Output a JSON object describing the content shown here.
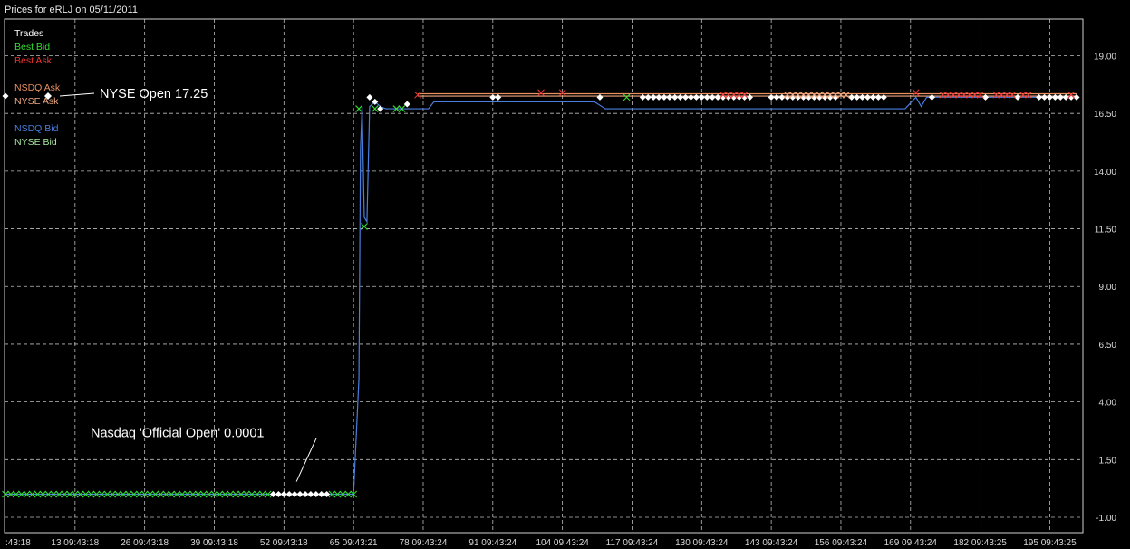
{
  "title": "Prices for  eRLJ  on  05/11/2011",
  "colors": {
    "trades": "#ffffff",
    "best_bid": "#33dd33",
    "best_ask": "#ee3333",
    "nsdq_ask": "#e89060",
    "nyse_ask": "#f0a880",
    "nsdq_bid": "#4a7fe0",
    "nyse_bid": "#a8e8a0",
    "grid": "#bcbcbc"
  },
  "legend": [
    {
      "label": "Trades",
      "color": "#ffffff"
    },
    {
      "label": "Best Bid",
      "color": "#33dd33"
    },
    {
      "label": "Best Ask",
      "color": "#ee3333"
    },
    {
      "label": "NSDQ Ask",
      "color": "#e89060"
    },
    {
      "label": "NYSE Ask",
      "color": "#f0a880"
    },
    {
      "label": "NSDQ Bid",
      "color": "#4a7fe0"
    },
    {
      "label": "NYSE Bid",
      "color": "#a8e8a0"
    }
  ],
  "annotations": [
    {
      "text": "NYSE Open 17.25",
      "x": 0,
      "y": 17.25
    },
    {
      "text": "Nasdaq 'Official Open' 0.0001",
      "x": 54,
      "y": 0.0001
    }
  ],
  "chart_data": {
    "type": "line",
    "title": "Prices for  eRLJ  on  05/11/2011",
    "xlim": [
      0,
      200
    ],
    "ylim": [
      -1.0,
      20.0
    ],
    "x_ticks": [
      {
        "x": 0,
        "label": ":43:18"
      },
      {
        "x": 13,
        "label": "13 09:43:18"
      },
      {
        "x": 26,
        "label": "26 09:43:18"
      },
      {
        "x": 39,
        "label": "39 09:43:18"
      },
      {
        "x": 52,
        "label": "52 09:43:18"
      },
      {
        "x": 65,
        "label": "65 09:43:21"
      },
      {
        "x": 78,
        "label": "78 09:43:24"
      },
      {
        "x": 91,
        "label": "91 09:43:24"
      },
      {
        "x": 104,
        "label": "104 09:43:24"
      },
      {
        "x": 117,
        "label": "117 09:43:24"
      },
      {
        "x": 130,
        "label": "130 09:43:24"
      },
      {
        "x": 143,
        "label": "143 09:43:24"
      },
      {
        "x": 156,
        "label": "156 09:43:24"
      },
      {
        "x": 169,
        "label": "169 09:43:24"
      },
      {
        "x": 182,
        "label": "182 09:43:25"
      },
      {
        "x": 195,
        "label": "195 09:43:25"
      }
    ],
    "y_ticks": [
      {
        "y": 19.0,
        "label": "19.00"
      },
      {
        "y": 16.5,
        "label": "16.50"
      },
      {
        "y": 14.0,
        "label": "14.00"
      },
      {
        "y": 11.5,
        "label": "11.50"
      },
      {
        "y": 9.0,
        "label": "9.00"
      },
      {
        "y": 6.5,
        "label": "6.50"
      },
      {
        "y": 4.0,
        "label": "4.00"
      },
      {
        "y": 1.5,
        "label": "1.50"
      },
      {
        "y": -1.0,
        "label": "-1.00"
      }
    ],
    "grid": true,
    "legend_position": "top-left",
    "series": [
      {
        "name": "NSDQ Bid",
        "style": "line",
        "color": "#4a7fe0",
        "x": [
          0,
          65,
          66,
          66.3,
          66.6,
          67,
          67.5,
          68,
          69,
          70,
          71,
          72,
          74,
          76,
          78,
          79,
          80,
          81,
          85,
          90,
          100,
          110,
          112,
          113,
          120,
          130,
          140,
          150,
          160,
          168,
          170,
          171,
          172,
          175,
          180,
          190,
          200
        ],
        "y": [
          0.0001,
          0.0001,
          5.0,
          15.0,
          16.8,
          12.0,
          11.8,
          16.8,
          17.0,
          16.8,
          16.7,
          16.7,
          16.7,
          16.7,
          16.7,
          16.7,
          17.0,
          17.0,
          17.0,
          17.0,
          17.0,
          17.0,
          16.7,
          16.7,
          16.7,
          16.7,
          16.7,
          16.7,
          16.7,
          16.7,
          17.2,
          16.8,
          17.2,
          17.2,
          17.2,
          17.2,
          17.2
        ]
      },
      {
        "name": "NSDQ Ask",
        "style": "line",
        "color": "#e89060",
        "x": [
          77,
          200
        ],
        "y": [
          17.35,
          17.35
        ]
      },
      {
        "name": "NYSE Ask",
        "style": "line",
        "color": "#f0a880",
        "x": [
          77,
          200
        ],
        "y": [
          17.25,
          17.25
        ]
      },
      {
        "name": "Trades",
        "style": "diamond",
        "color": "#ffffff",
        "x": [
          0,
          50,
          51,
          52,
          53,
          54,
          55,
          56,
          57,
          58,
          59,
          60,
          68,
          69,
          70,
          75,
          91,
          92,
          111,
          119,
          120,
          121,
          122,
          123,
          124,
          125,
          126,
          127,
          128,
          129,
          130,
          131,
          132,
          133,
          134,
          135,
          136,
          137,
          138,
          139,
          143,
          144,
          145,
          146,
          147,
          148,
          149,
          150,
          151,
          152,
          153,
          154,
          155,
          158,
          159,
          160,
          161,
          162,
          163,
          164,
          173,
          183,
          189,
          193,
          194,
          195,
          196,
          197,
          198,
          199,
          200
        ],
        "y": [
          17.25,
          0.0001,
          0.0001,
          0.0001,
          0.0001,
          0.0001,
          0.0001,
          0.0001,
          0.0001,
          0.0001,
          0.0001,
          0.0001,
          17.2,
          17.0,
          16.7,
          16.9,
          17.2,
          17.2,
          17.2,
          17.2,
          17.2,
          17.2,
          17.2,
          17.2,
          17.2,
          17.2,
          17.2,
          17.2,
          17.2,
          17.2,
          17.2,
          17.2,
          17.2,
          17.2,
          17.2,
          17.2,
          17.2,
          17.2,
          17.2,
          17.2,
          17.2,
          17.2,
          17.2,
          17.2,
          17.2,
          17.2,
          17.2,
          17.2,
          17.2,
          17.2,
          17.2,
          17.2,
          17.2,
          17.2,
          17.2,
          17.2,
          17.2,
          17.2,
          17.2,
          17.2,
          17.2,
          17.2,
          17.2,
          17.2,
          17.2,
          17.2,
          17.2,
          17.2,
          17.2,
          17.2,
          17.2
        ]
      },
      {
        "name": "Best Bid",
        "style": "x",
        "color": "#33dd33",
        "x": [
          0,
          1,
          2,
          3,
          4,
          5,
          6,
          7,
          8,
          9,
          10,
          11,
          12,
          13,
          14,
          15,
          16,
          17,
          18,
          19,
          20,
          21,
          22,
          23,
          24,
          25,
          26,
          27,
          28,
          29,
          30,
          31,
          32,
          33,
          34,
          35,
          36,
          37,
          38,
          39,
          40,
          41,
          42,
          43,
          44,
          45,
          46,
          47,
          48,
          49,
          61,
          62,
          63,
          64,
          65,
          66,
          67,
          69,
          73,
          74,
          116
        ],
        "y": [
          0.0001,
          0.0001,
          0.0001,
          0.0001,
          0.0001,
          0.0001,
          0.0001,
          0.0001,
          0.0001,
          0.0001,
          0.0001,
          0.0001,
          0.0001,
          0.0001,
          0.0001,
          0.0001,
          0.0001,
          0.0001,
          0.0001,
          0.0001,
          0.0001,
          0.0001,
          0.0001,
          0.0001,
          0.0001,
          0.0001,
          0.0001,
          0.0001,
          0.0001,
          0.0001,
          0.0001,
          0.0001,
          0.0001,
          0.0001,
          0.0001,
          0.0001,
          0.0001,
          0.0001,
          0.0001,
          0.0001,
          0.0001,
          0.0001,
          0.0001,
          0.0001,
          0.0001,
          0.0001,
          0.0001,
          0.0001,
          0.0001,
          0.0001,
          0.0001,
          0.0001,
          0.0001,
          0.0001,
          0.0001,
          16.7,
          11.6,
          16.7,
          16.7,
          16.7,
          17.2
        ]
      },
      {
        "name": "Best Ask",
        "style": "x",
        "color": "#ee3333",
        "x": [
          77,
          100,
          104,
          134,
          135,
          136,
          137,
          138,
          170,
          175,
          176,
          177,
          178,
          179,
          180,
          181,
          182,
          185,
          186,
          187,
          188,
          190,
          191,
          199
        ],
        "y": [
          17.3,
          17.4,
          17.4,
          17.3,
          17.3,
          17.3,
          17.3,
          17.3,
          17.4,
          17.3,
          17.3,
          17.3,
          17.3,
          17.3,
          17.3,
          17.3,
          17.3,
          17.3,
          17.3,
          17.3,
          17.3,
          17.3,
          17.3,
          17.3
        ]
      },
      {
        "name": "NYSE Ask",
        "style": "x",
        "color": "#f0a880",
        "x": [
          146,
          147,
          148,
          149,
          150,
          151,
          152,
          153,
          154,
          155,
          156,
          157
        ],
        "y": [
          17.3,
          17.3,
          17.3,
          17.3,
          17.3,
          17.3,
          17.3,
          17.3,
          17.3,
          17.3,
          17.3,
          17.3
        ]
      }
    ]
  }
}
